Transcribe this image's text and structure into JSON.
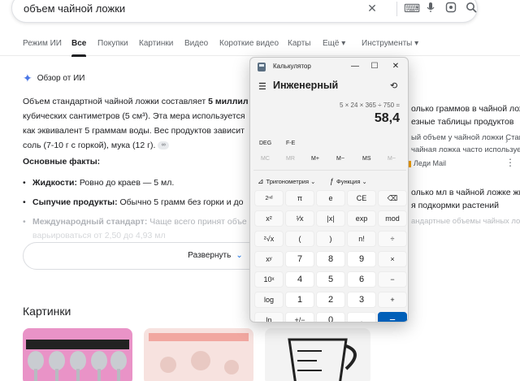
{
  "search": {
    "query": "объем чайной ложки"
  },
  "search_icons": [
    "clear-icon",
    "keyboard-icon",
    "mic-icon",
    "lens-icon",
    "search-icon"
  ],
  "tabs": [
    "Режим ИИ",
    "Все",
    "Покупки",
    "Картинки",
    "Видео",
    "Короткие видео",
    "Карты",
    "Ещё",
    "Инструменты"
  ],
  "ai": {
    "header": "Обзор от ИИ",
    "line1_a": "Объем стандартной чайной ложки составляет ",
    "line1_b": "5 миллил",
    "line2": "кубических сантиметров (5 см³). Эта мера используется",
    "line3": "как эквивалент 5 граммам воды. Вес продуктов зависит",
    "line4": "соль (7-10 г с горкой), мука (12 г).",
    "facts_title": "Основные факты:",
    "fact1_b": "Жидкости:",
    "fact1": " Ровно до краев — 5 мл.",
    "fact2_b": "Сыпучие продукты:",
    "fact2": " Обычно 5 грамм без горки и до",
    "fact3_b": "Международный стандарт:",
    "fact3": " Чаще всего принят объе",
    "fact4": "варьироваться от 2,50 до 4,93 мл",
    "expand": "Развернуть"
  },
  "pictures": {
    "title": "Картинки"
  },
  "right": {
    "r1_title": "олько граммов в чайной ложк",
    "r1_snip1": "езные таблицы продуктов",
    "r1_snip2": "ый объем у чайной ложки Станд",
    "r1_snip3": "чайная ложка часто используется в",
    "r1_src": "Леди Mail",
    "r2_title": "олько мл в чайной ложке жи",
    "r2_snip1": "я подкормки растений",
    "r2_snip2": "андартные объемы чайных ложек"
  },
  "calculator": {
    "window_title": "Калькулятор",
    "mode": "Инженерный",
    "expression": "5 × 24 × 365 ÷ 750 =",
    "result": "58,4",
    "deg": "DEG",
    "fe": "F-E",
    "memory": [
      "MC",
      "MR",
      "M+",
      "M−",
      "MS",
      "M~"
    ],
    "trig": "Тригонометрия",
    "func": "Функция",
    "keys": [
      [
        "2ⁿᵈ",
        "π",
        "e",
        "CE",
        "⌫"
      ],
      [
        "x²",
        "¹⁄x",
        "|x|",
        "exp",
        "mod"
      ],
      [
        "²√x",
        "(",
        ")",
        "n!",
        "÷"
      ],
      [
        "xʸ",
        "7",
        "8",
        "9",
        "×"
      ],
      [
        "10ˣ",
        "4",
        "5",
        "6",
        "−"
      ],
      [
        "log",
        "1",
        "2",
        "3",
        "+"
      ],
      [
        "ln",
        "+/−",
        "0",
        ",",
        "="
      ]
    ]
  }
}
